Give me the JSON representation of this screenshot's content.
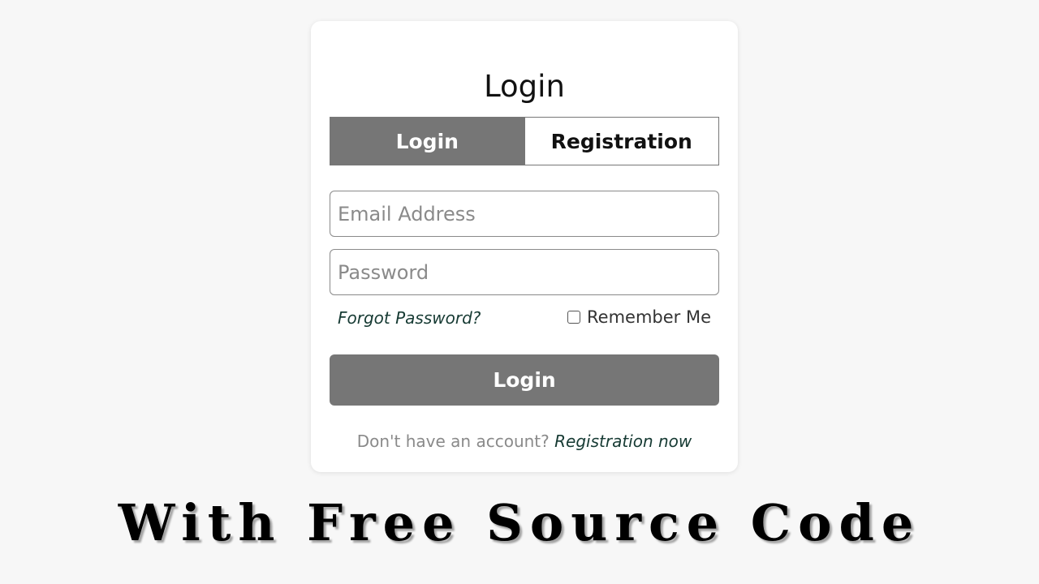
{
  "card": {
    "title": "Login",
    "tabs": [
      {
        "label": "Login",
        "active": true
      },
      {
        "label": "Registration",
        "active": false
      }
    ],
    "email_placeholder": "Email Address",
    "password_placeholder": "Password",
    "forgot_password_label": "Forgot Password?",
    "remember_me_label": "Remember Me",
    "remember_me_checked": false,
    "login_button_label": "Login",
    "signup_prompt": "Don't have an account?",
    "signup_link_label": "Registration now"
  },
  "caption": "With Free Source Code",
  "colors": {
    "page_background": "#f7f7f7",
    "card_background": "#ffffff",
    "accent_gray": "#767676",
    "link_color": "#163a33"
  }
}
